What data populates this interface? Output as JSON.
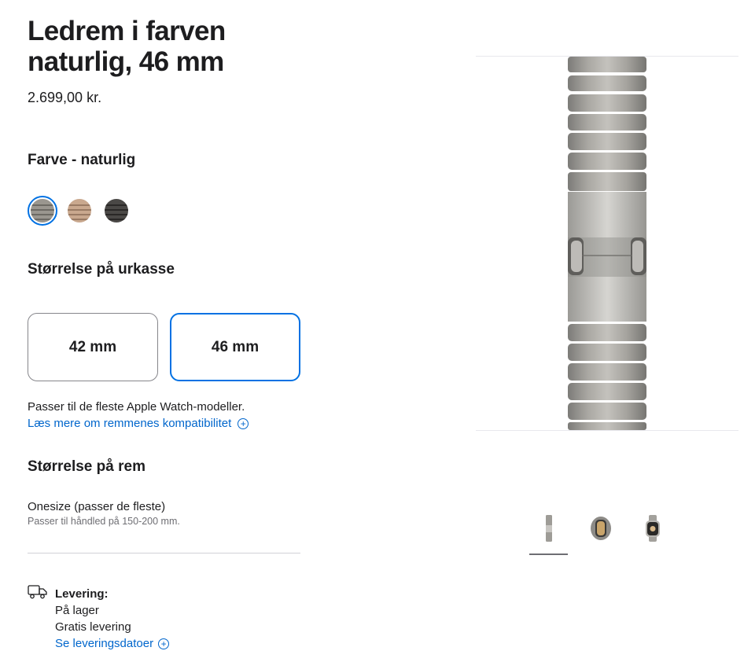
{
  "product": {
    "title": "Ledrem i farven naturlig, 46 mm",
    "price": "2.699,00 kr."
  },
  "color": {
    "heading": "Farve - naturlig",
    "swatches": [
      {
        "name": "naturlig",
        "color": "#9a968f",
        "selected": true
      },
      {
        "name": "guld",
        "color": "#c9a88e",
        "selected": false
      },
      {
        "name": "skifer",
        "color": "#4a4846",
        "selected": false
      }
    ]
  },
  "case_size": {
    "heading": "Størrelse på urkasse",
    "options": [
      {
        "label": "42 mm",
        "selected": false
      },
      {
        "label": "46 mm",
        "selected": true
      }
    ],
    "compat_text": "Passer til de fleste Apple Watch-modeller.",
    "compat_link": "Læs mere om remmenes kompatibilitet"
  },
  "band_size": {
    "heading": "Størrelse på rem",
    "value": "Onesize (passer de fleste)",
    "sub": "Passer til håndled på 150-200 mm."
  },
  "delivery": {
    "label": "Levering:",
    "stock": "På lager",
    "shipping": "Gratis levering",
    "link": "Se leveringsdatoer"
  },
  "gallery": {
    "thumbnails": [
      "band-thumbnail",
      "watch-side-thumbnail",
      "watch-front-thumbnail"
    ],
    "active_index": 0
  },
  "colors": {
    "accent": "#0071e3",
    "link": "#0066cc"
  }
}
